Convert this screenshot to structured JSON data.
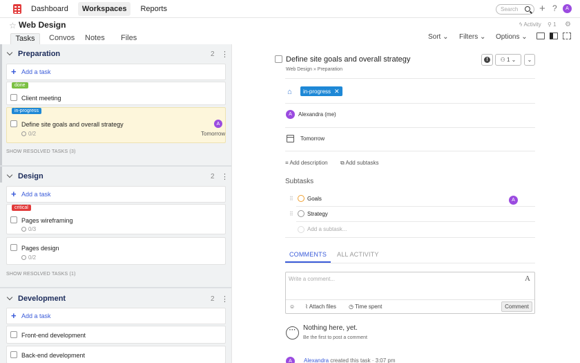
{
  "nav": {
    "items": [
      "Dashboard",
      "Workspaces",
      "Reports"
    ],
    "search_placeholder": "Search",
    "avatar_initial": "A"
  },
  "header": {
    "title": "Web Design",
    "activity": "Activity",
    "members_count": "1"
  },
  "tabs": [
    "Tasks",
    "Convos",
    "Notes",
    "Files"
  ],
  "toolbar": {
    "sort": "Sort",
    "filters": "Filters",
    "options": "Options"
  },
  "groups": [
    {
      "name": "Preparation",
      "count": "2",
      "add_label": "Add a task",
      "show_resolved": "SHOW RESOLVED TASKS (3)",
      "tasks": [
        {
          "name": "Client meeting",
          "badge": "done",
          "badge_color": "#7bc043"
        },
        {
          "name": "Define site goals and overall strategy",
          "badge": "in-progress",
          "badge_color": "#1e88d6",
          "subtasks": "0/2",
          "due": "Tomorrow",
          "avatar": "A"
        }
      ]
    },
    {
      "name": "Design",
      "count": "2",
      "add_label": "Add a task",
      "show_resolved": "SHOW RESOLVED TASKS (1)",
      "tasks": [
        {
          "name": "Pages wireframing",
          "badge": "critical",
          "badge_color": "#e23b3b",
          "subtasks": "0/3"
        },
        {
          "name": "Pages design",
          "subtasks": "0/2"
        }
      ]
    },
    {
      "name": "Development",
      "count": "2",
      "add_label": "Add a task",
      "tasks": [
        {
          "name": "Front-end development"
        },
        {
          "name": "Back-end development"
        }
      ]
    }
  ],
  "detail": {
    "title": "Define site goals and overall strategy",
    "breadcrumb": "Web Design » Preparation",
    "assignee_count": "1",
    "tag": "in-progress",
    "assignee": "Alexandra (me)",
    "assignee_initial": "A",
    "due": "Tomorrow",
    "add_description": "Add description",
    "add_subtasks": "Add subtasks",
    "subtasks_heading": "Subtasks",
    "subtasks": [
      {
        "name": "Goals",
        "avatar": "A"
      },
      {
        "name": "Strategy"
      }
    ],
    "add_subtask_placeholder": "Add a subtask...",
    "comment_tabs": [
      "COMMENTS",
      "ALL ACTIVITY"
    ],
    "comment_placeholder": "Write a comment...",
    "attach_files": "Attach files",
    "time_spent": "Time spent",
    "comment_button": "Comment",
    "empty_title": "Nothing here, yet.",
    "empty_sub": "Be the first to post a comment",
    "activity_user": "Alexandra",
    "activity_text": "created this task · 3:07 pm"
  }
}
